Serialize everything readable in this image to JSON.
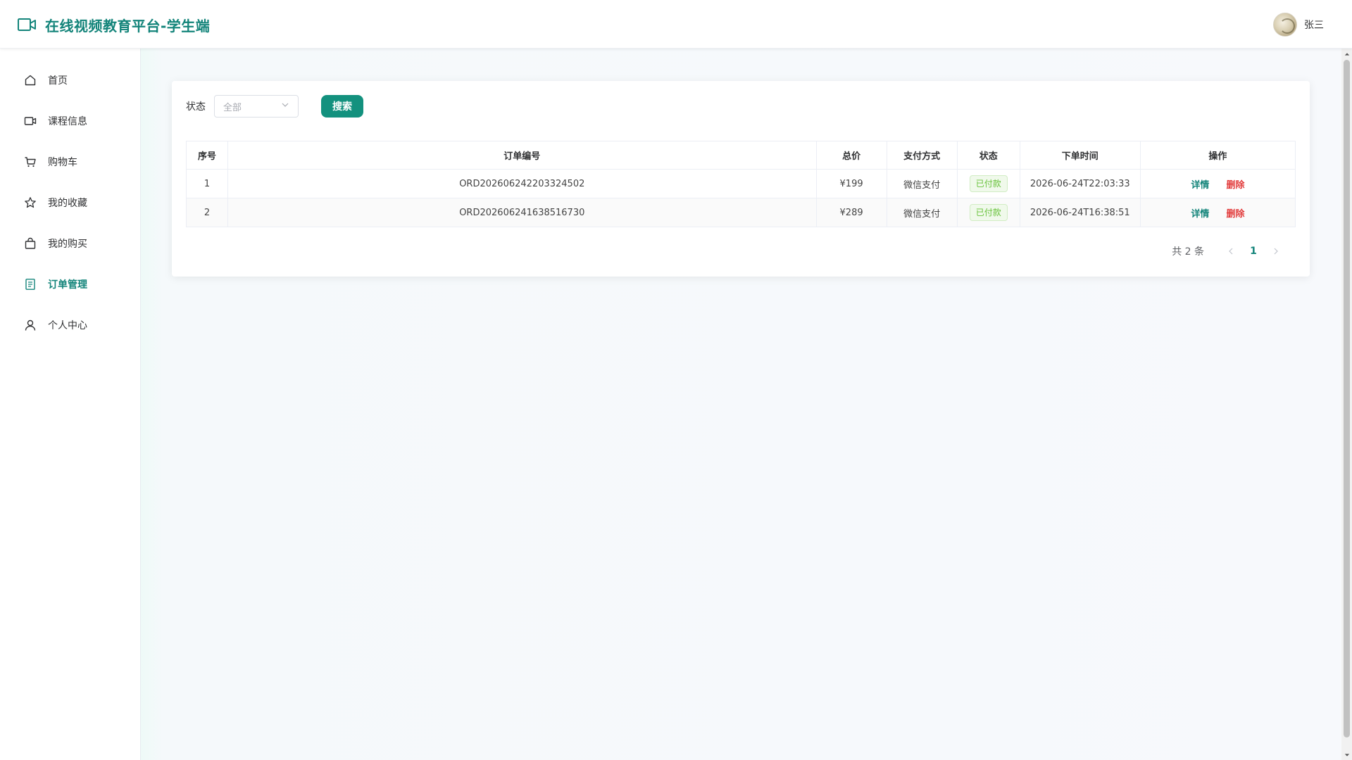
{
  "header": {
    "title": "在线视频教育平台-学生端",
    "user_name": "张三",
    "brand_icon": "video-camera-icon",
    "accent_color": "#13847a"
  },
  "sidebar": {
    "items": [
      {
        "label": "首页",
        "icon": "home-icon",
        "active": false
      },
      {
        "label": "课程信息",
        "icon": "video-camera-icon",
        "active": false
      },
      {
        "label": "购物车",
        "icon": "cart-icon",
        "active": false
      },
      {
        "label": "我的收藏",
        "icon": "star-icon",
        "active": false
      },
      {
        "label": "我的购买",
        "icon": "shopping-bag-icon",
        "active": false
      },
      {
        "label": "订单管理",
        "icon": "document-icon",
        "active": true
      },
      {
        "label": "个人中心",
        "icon": "user-icon",
        "active": false
      }
    ]
  },
  "filter": {
    "status_label": "状态",
    "status_value": "全部",
    "search_label": "搜索"
  },
  "table": {
    "columns": [
      "序号",
      "订单编号",
      "总价",
      "支付方式",
      "状态",
      "下单时间",
      "操作"
    ],
    "rows": [
      {
        "index": "1",
        "order_no": "ORD202606242203324502",
        "price": "¥199",
        "pay_method": "微信支付",
        "status": "已付款",
        "time": "2026-06-24T22:03:33",
        "detail": "详情",
        "delete": "删除"
      },
      {
        "index": "2",
        "order_no": "ORD202606241638516730",
        "price": "¥289",
        "pay_method": "微信支付",
        "status": "已付款",
        "time": "2026-06-24T16:38:51",
        "detail": "详情",
        "delete": "删除"
      }
    ]
  },
  "pagination": {
    "total_text": "共 2 条",
    "current_page": "1"
  }
}
